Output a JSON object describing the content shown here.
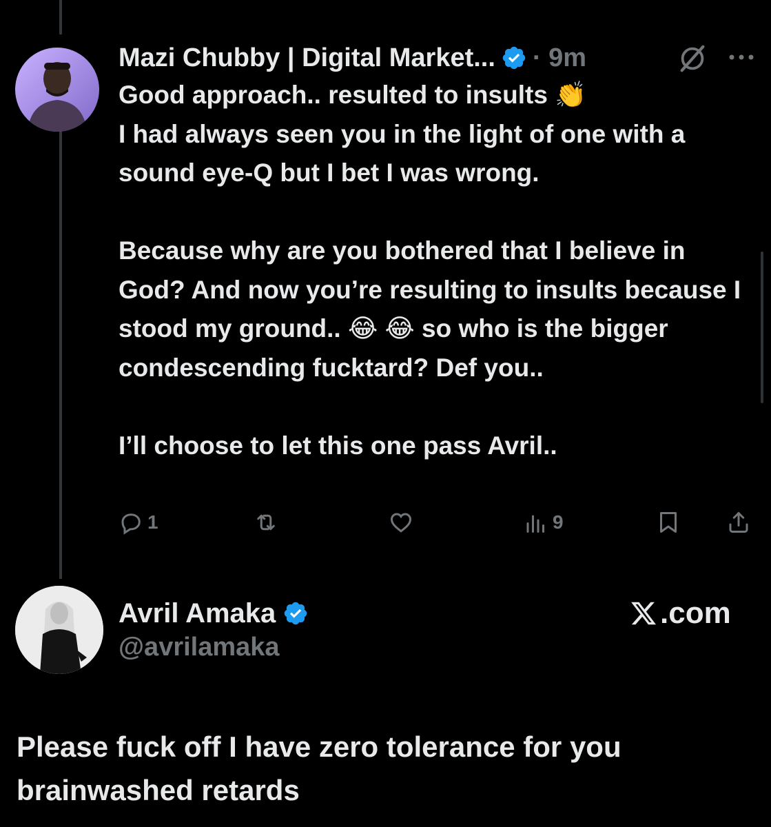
{
  "tweet": {
    "author_name": "Mazi Chubby | Digital Market...",
    "time": "· 9m",
    "text": "Good approach.. resulted to insults 👏\nI had always seen you in the light of one with a sound eye-Q but I bet I was wrong.\n\nBecause why are you bothered that I believe in God? And now you’re resulting to insults because I stood my ground.. 😂 😂 so who is the bigger condescending fucktard? Def you..\n\nI’ll choose to let this one pass Avril..",
    "actions": {
      "reply_count": "1",
      "retweet_count": "",
      "like_count": "",
      "views_count": "9"
    }
  },
  "reply": {
    "author_name": "Avril Amaka",
    "handle": "@avrilamaka",
    "source": ".com",
    "text": "Please fuck off I have zero tolerance for you brainwashed retards"
  },
  "colors": {
    "background": "#000000",
    "text": "#e7e9ea",
    "muted": "#71767b",
    "verified": "#1d9bf0",
    "thread_line": "#333639"
  },
  "icons": [
    "verified-badge-icon",
    "grok-icon",
    "more-icon",
    "reply-icon",
    "retweet-icon",
    "like-icon",
    "views-icon",
    "bookmark-icon",
    "share-icon",
    "x-logo-icon"
  ]
}
